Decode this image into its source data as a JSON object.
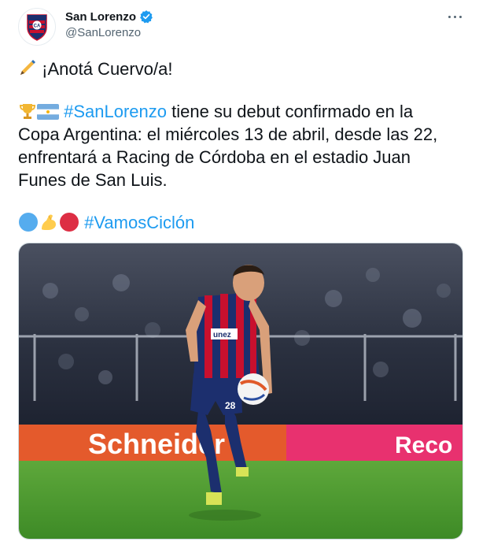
{
  "author": {
    "display_name": "San Lorenzo",
    "handle": "@SanLorenzo",
    "verified_icon": "verified-badge-icon",
    "avatar_icon": "san-lorenzo-crest-icon"
  },
  "menu": {
    "icon": "more-options-icon"
  },
  "tweet": {
    "line1_text": "¡Anotá Cuervo/a!",
    "line2_hashtag": "#SanLorenzo",
    "line2_text": " tiene su debut confirmado en la",
    "line3_text": "Copa Argentina: el miércoles 13 de abril, desde las 22,",
    "line4_text": "enfrentará a Racing de Córdoba en el estadio Juan",
    "line5_text": "Funes de San Luis.",
    "line6_hashtag": "#VamosCiclón"
  },
  "media": {
    "ad_board_left": "Schneider",
    "ad_board_right": "Reco",
    "jersey_sponsor": "unez",
    "jersey_number": "28"
  },
  "colors": {
    "hashtag": "#1d9bf0",
    "club_blue": "#1c2f6e",
    "club_red": "#c8102e",
    "verified": "#1d9bf0"
  }
}
